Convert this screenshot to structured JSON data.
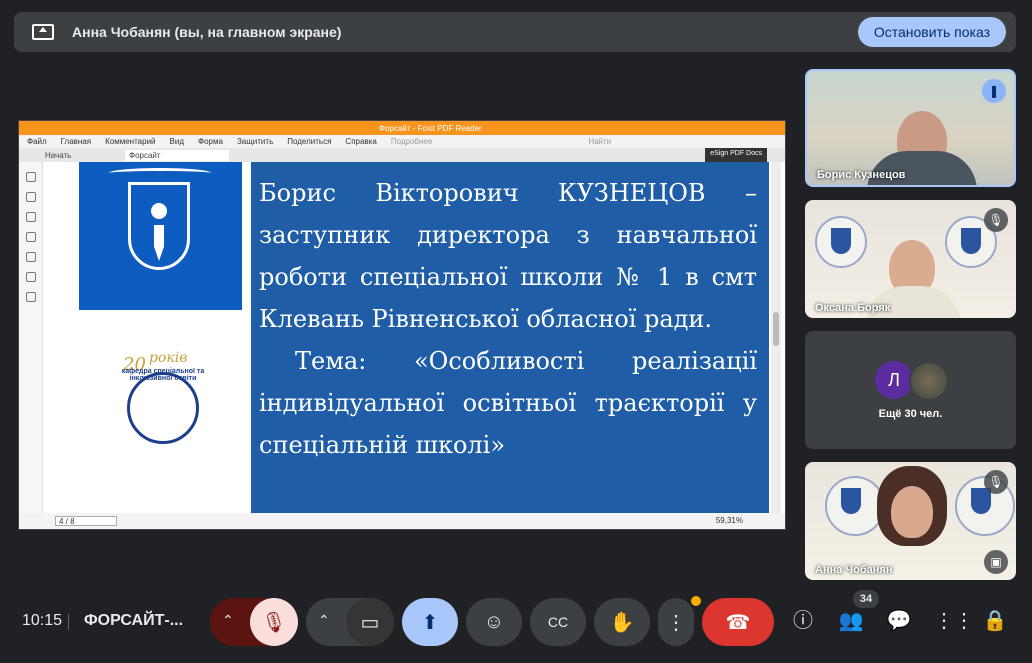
{
  "banner": {
    "title": "Анна Чобанян (вы, на главном экране)",
    "stop_label": "Остановить показ"
  },
  "reader": {
    "window_title": "Форсайт - Foxit PDF Reader",
    "menu": [
      "Файл",
      "Главная",
      "Комментарий",
      "Вид",
      "Форма",
      "Защитить",
      "Поделиться",
      "Справка",
      "Подробнее"
    ],
    "search_placeholder": "Найти",
    "tabs": [
      "Начать",
      "Форсайт"
    ],
    "esign": "eSign PDF Docs",
    "page_indicator": "4 / 8",
    "zoom": "59,31%"
  },
  "slide": {
    "logo_years": "20",
    "logo_word": "років",
    "logo_arc": "кафедра спеціальної та інклюзивної освіти",
    "p1": "Борис Вікторович КУЗНЕЦОВ – заступник директора з навчальної роботи спеціальної школи № 1 в смт Клевань Рівненської обласної ради.",
    "p2": "Тема: «Особливості реалізації індивідуальної освітньої траєкторії у спеціальній школі»"
  },
  "participants": [
    {
      "name": "Борис Кузнецов",
      "speaking": true
    },
    {
      "name": "Оксана Боряк",
      "muted": true
    },
    {
      "name": "Анна Чобанян",
      "muted": true
    }
  ],
  "more": {
    "initial": "Л",
    "label": "Ещё 30 чел."
  },
  "bottom": {
    "time": "10:15",
    "meeting": "ФОРСАЙТ-...",
    "people_count": "34"
  },
  "colors": {
    "accent": "#a8c7fa",
    "hangup": "#dc362e",
    "slide_blue": "#1f5ea7",
    "foxit_orange": "#f7941d"
  }
}
